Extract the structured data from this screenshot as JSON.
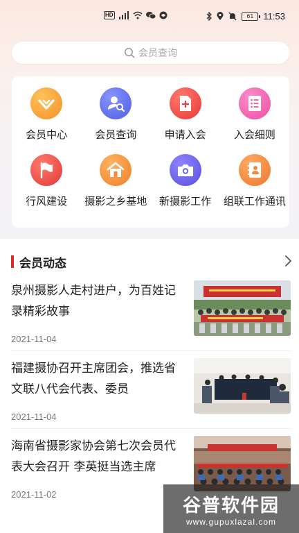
{
  "status_bar": {
    "left_icons": [
      "hd-badge",
      "4g-signal-icon",
      "wifi-icon",
      "wechat-icon",
      "app-icon"
    ],
    "hd_label": "HD",
    "battery_level": "61",
    "time": "11:53"
  },
  "search": {
    "placeholder": "会员查询"
  },
  "menu": {
    "items": [
      {
        "label": "会员中心",
        "icon": "heart-icon",
        "color": "#f39a2c"
      },
      {
        "label": "会员查询",
        "icon": "user-search-icon",
        "color": "#5f70e8"
      },
      {
        "label": "申请入会",
        "icon": "document-add-icon",
        "color": "#ef4b4b"
      },
      {
        "label": "入会细则",
        "icon": "list-icon",
        "color": "#ef5ea8"
      },
      {
        "label": "行风建设",
        "icon": "flag-icon",
        "color": "#ee4d48"
      },
      {
        "label": "摄影之乡基地",
        "icon": "home-icon",
        "color": "#f3953a"
      },
      {
        "label": "新摄影工作",
        "icon": "camera-icon",
        "color": "#6a5fe6"
      },
      {
        "label": "组联工作通讯",
        "icon": "contact-book-icon",
        "color": "#f28a3d"
      }
    ]
  },
  "news": {
    "section_title": "会员动态",
    "items": [
      {
        "title": "泉州摄影人走村进户，为百姓记录精彩故事",
        "date": "2021-11-04"
      },
      {
        "title": "福建摄协召开主席团会，推选省文联八代会代表、委员",
        "date": "2021-11-04"
      },
      {
        "title": "海南省摄影家协会第七次会员代表大会召开 李英挺当选主席",
        "date": "2021-11-02"
      }
    ]
  },
  "watermark": {
    "title": "谷普软件园",
    "url": "www.gupuxlazal.com"
  }
}
